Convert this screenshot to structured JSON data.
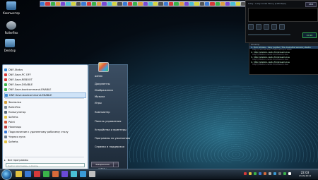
{
  "desktop": {
    "icons": [
      {
        "label": "Компьютер",
        "icon": "computer-icon"
      },
      {
        "label": "Rollerflex",
        "icon": "folder-icon"
      },
      {
        "label": "Desktop",
        "icon": "folder-icon"
      }
    ]
  },
  "quicklaunch": {
    "icon_count": 40
  },
  "player": {
    "title": "Lizzy - Lady Loves Fancy (128 kbps)",
    "badge": "KBM",
    "time": "00:26"
  },
  "playlist": {
    "header": "Winamp",
    "items": [
      {
        "title": "1. Tom Amoss - Very Jupiter (The Calcutta Version) Radio",
        "url": "http://radiostream.net/live/mp3-128k"
      },
      {
        "title": "2. http://station-radio.fm/stream-live",
        "url": "http://station-radio.fm/stream-live"
      },
      {
        "title": "3. http://station-radio.fm/stream-live",
        "url": "http://station-radio.fm/stream-live"
      },
      {
        "title": "4. http://station-radio.fm/stream-live",
        "url": "http://station-radio.fm/stream-live"
      }
    ]
  },
  "start_menu": {
    "left_items": [
      {
        "label": "DNF-Status"
      },
      {
        "label": "DNF-Save-PC OFF"
      },
      {
        "label": "DNF-Save-REBOOT"
      },
      {
        "label": "DNF-Save-DISABLE"
      },
      {
        "label": "DNF-Save-bootcommand-ENABLE"
      },
      {
        "label": "DNF-Save-bootcommand-ENABLE"
      },
      {
        "label": "Звонилка"
      },
      {
        "label": "Rollerflex"
      },
      {
        "label": "Калькулятор"
      },
      {
        "label": "Sofrehs"
      },
      {
        "label": "Paint"
      },
      {
        "label": "Ножницы"
      },
      {
        "label": "Подключение к удаленному рабочему столу"
      },
      {
        "label": "Черная лупа"
      },
      {
        "label": "Sofrehs"
      }
    ],
    "all_programs": "Все программы",
    "search_placeholder": "Найти программы и файлы",
    "user_name": "admin",
    "right_items": [
      {
        "label": "Документы"
      },
      {
        "label": "Изображения"
      },
      {
        "label": "Музыка"
      },
      {
        "label": "Игры"
      },
      {
        "label": "Компьютер"
      },
      {
        "label": "Панель управления"
      },
      {
        "label": "Устройства и принтеры"
      },
      {
        "label": "Программы по умолчанию"
      },
      {
        "label": "Справка и поддержка"
      }
    ],
    "shutdown_label": "Завершение работы"
  },
  "taskbar": {
    "pinned_count": 9,
    "clock_time": "22:03",
    "clock_date": "13.09.2014"
  },
  "colors": {
    "accent": "#1c5f9c",
    "selection": "#cfe3f7"
  }
}
